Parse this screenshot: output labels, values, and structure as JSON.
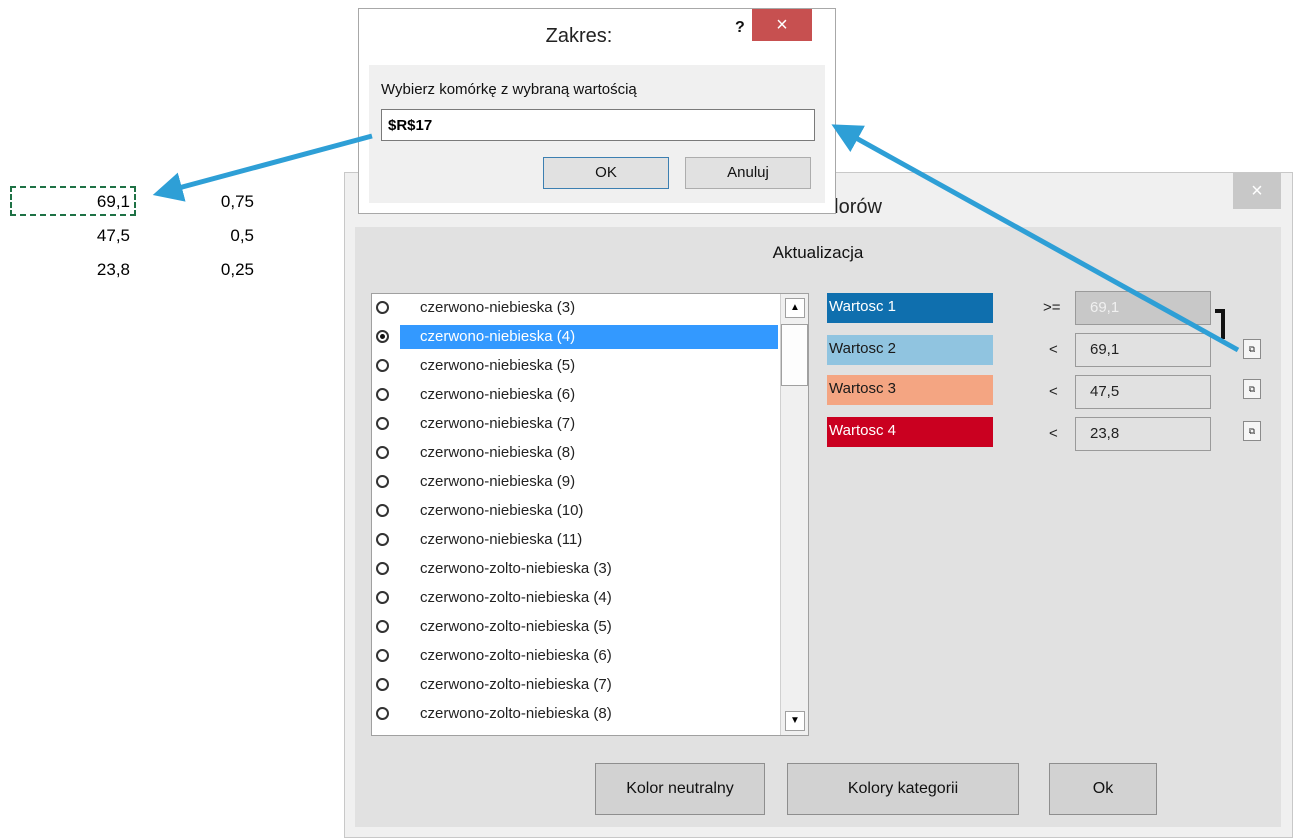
{
  "spreadsheet": {
    "rows": [
      {
        "a": "69,1",
        "b": "0,75"
      },
      {
        "a": "47,5",
        "b": "0,5"
      },
      {
        "a": "23,8",
        "b": "0,25"
      }
    ]
  },
  "main_dialog": {
    "title_visible": "olorów",
    "close_label": "×",
    "section_title": "Aktualizacja",
    "list_items": [
      {
        "label": "czerwono-niebieska (3)",
        "checked": false
      },
      {
        "label": "czerwono-niebieska (4)",
        "checked": true
      },
      {
        "label": "czerwono-niebieska (5)",
        "checked": false
      },
      {
        "label": "czerwono-niebieska (6)",
        "checked": false
      },
      {
        "label": "czerwono-niebieska (7)",
        "checked": false
      },
      {
        "label": "czerwono-niebieska (8)",
        "checked": false
      },
      {
        "label": "czerwono-niebieska (9)",
        "checked": false
      },
      {
        "label": "czerwono-niebieska (10)",
        "checked": false
      },
      {
        "label": "czerwono-niebieska (11)",
        "checked": false
      },
      {
        "label": "czerwono-zolto-niebieska (3)",
        "checked": false
      },
      {
        "label": "czerwono-zolto-niebieska (4)",
        "checked": false
      },
      {
        "label": "czerwono-zolto-niebieska (5)",
        "checked": false
      },
      {
        "label": "czerwono-zolto-niebieska (6)",
        "checked": false
      },
      {
        "label": "czerwono-zolto-niebieska (7)",
        "checked": false
      },
      {
        "label": "czerwono-zolto-niebieska (8)",
        "checked": false
      }
    ],
    "scroll_up": "▲",
    "scroll_down": "▼",
    "values": [
      {
        "label": "Wartosc 1",
        "color": "#0f6fae",
        "text_color": "#ffffff",
        "op": ">=",
        "value": "69,1",
        "disabled": true
      },
      {
        "label": "Wartosc 2",
        "color": "#90c4e0",
        "text_color": "#1a1a1a",
        "op": "<",
        "value": "69,1",
        "disabled": false
      },
      {
        "label": "Wartosc 3",
        "color": "#f4a582",
        "text_color": "#1a1a1a",
        "op": "<",
        "value": "47,5",
        "disabled": false
      },
      {
        "label": "Wartosc 4",
        "color": "#ca0020",
        "text_color": "#ffffff",
        "op": "<",
        "value": "23,8",
        "disabled": false
      }
    ],
    "ref_icon": "⧉",
    "buttons": {
      "neutral": "Kolor neutralny",
      "categories": "Kolory kategorii",
      "ok": "Ok"
    }
  },
  "range_dialog": {
    "title": "Zakres:",
    "help": "?",
    "close": "×",
    "prompt": "Wybierz komórkę z wybraną wartością",
    "value": "$R$17",
    "ok": "OK",
    "cancel": "Anuluj"
  },
  "arrow_color": "#2e9fd6"
}
